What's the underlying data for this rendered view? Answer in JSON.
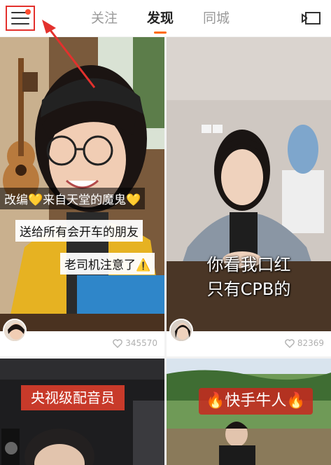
{
  "header": {
    "tabs": [
      {
        "label": "关注",
        "active": false
      },
      {
        "label": "发现",
        "active": true
      },
      {
        "label": "同城",
        "active": false
      }
    ],
    "accent_color": "#ff6a00",
    "annotation_color": "#e3312d"
  },
  "feed": [
    {
      "captions": [
        "改编💛来自天堂的魔鬼💛",
        "送给所有会开车的朋友",
        "老司机注意了⚠️"
      ],
      "likes": "345570"
    },
    {
      "subtitle_lines": [
        "你看我口红",
        "只有CPB的"
      ],
      "likes": "82369"
    },
    {
      "banner": "央视级配音员"
    },
    {
      "banner": "🔥快手牛人🔥"
    }
  ]
}
